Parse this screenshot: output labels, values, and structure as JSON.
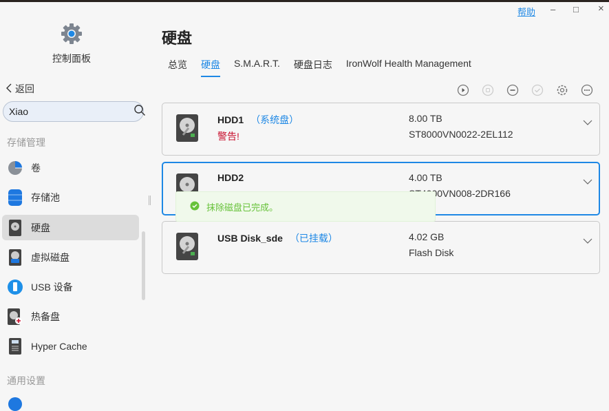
{
  "window": {
    "help": "帮助",
    "minimize": "–",
    "maximize": "□",
    "close": "×"
  },
  "sidebar": {
    "app_title": "控制面板",
    "back": "返回",
    "search": {
      "value": "Xiao",
      "placeholder": ""
    },
    "sections": [
      {
        "label": "存储管理"
      },
      {
        "label": "通用设置"
      }
    ],
    "items": [
      {
        "label": "卷",
        "icon": "volume-pie-icon"
      },
      {
        "label": "存储池",
        "icon": "storage-pool-icon"
      },
      {
        "label": "硬盘",
        "icon": "hdd-icon",
        "active": true
      },
      {
        "label": "虚拟磁盘",
        "icon": "virtual-disk-icon"
      },
      {
        "label": "USB 设备",
        "icon": "usb-icon"
      },
      {
        "label": "热备盘",
        "icon": "hot-spare-icon"
      },
      {
        "label": "Hyper Cache",
        "icon": "ssd-cache-icon"
      }
    ]
  },
  "main": {
    "title": "硬盘",
    "tabs": [
      {
        "label": "总览"
      },
      {
        "label": "硬盘",
        "active": true
      },
      {
        "label": "S.M.A.R.T."
      },
      {
        "label": "硬盘日志"
      },
      {
        "label": "IronWolf Health Management"
      }
    ],
    "toolbar": [
      "play-icon",
      "stop-icon",
      "remove-icon",
      "check-icon",
      "gear-icon",
      "more-icon"
    ],
    "disks": [
      {
        "name": "HDD1",
        "tag": "（系统盘）",
        "status": "警告!",
        "size": "8.00 TB",
        "model": "ST8000VN0022-2EL112"
      },
      {
        "name": "HDD2",
        "tag": "",
        "status": "",
        "size": "4.00 TB",
        "model": "ST4000VN008-2DR166",
        "selected": true
      },
      {
        "name": "USB Disk_sde",
        "tag": "（已挂载）",
        "status": "",
        "size": "4.02 GB",
        "model": "Flash Disk"
      }
    ],
    "toast": "抹除磁盘已完成。"
  },
  "colors": {
    "accent": "#1e88e5",
    "warning": "#c8102e",
    "success": "#67c23a"
  }
}
